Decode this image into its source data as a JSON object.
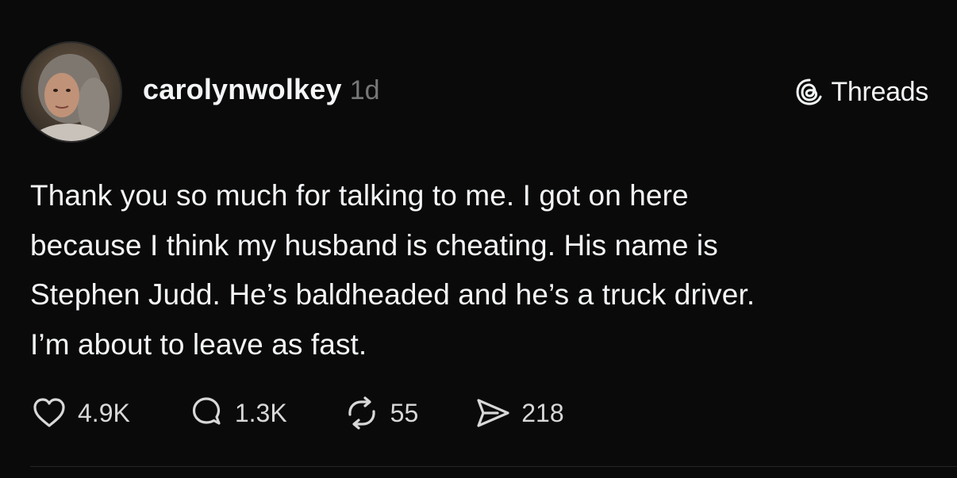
{
  "post": {
    "username": "carolynwolkey",
    "timestamp": "1d",
    "brand": {
      "label": "Threads",
      "icon": "threads-logo-icon"
    },
    "body_lines": [
      "Thank you so much for talking to me. I got on here",
      "because I think my husband is cheating. His name is",
      "Stephen Judd. He’s baldheaded and he’s a truck driver.",
      "I’m about to leave as fast."
    ],
    "actions": {
      "likes": {
        "icon": "heart-icon",
        "count": "4.9K"
      },
      "replies": {
        "icon": "comment-icon",
        "count": "1.3K"
      },
      "reposts": {
        "icon": "repost-icon",
        "count": "55"
      },
      "shares": {
        "icon": "send-icon",
        "count": "218"
      }
    }
  },
  "colors": {
    "background": "#0a0a0a",
    "primary_text": "#f3f5f7",
    "secondary_text": "#777777",
    "icon": "#d8d8d8"
  }
}
